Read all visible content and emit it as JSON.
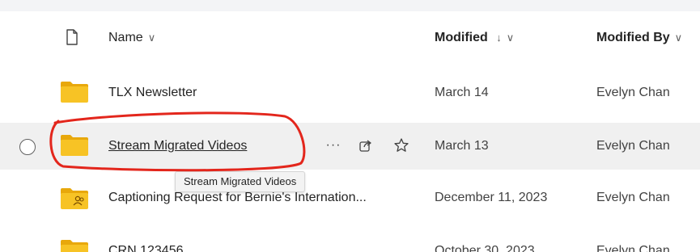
{
  "header": {
    "name_label": "Name",
    "name_chevron": "∨",
    "modified_label": "Modified",
    "modified_sort": "↓",
    "modified_chevron": "∨",
    "modified_by_label": "Modified By",
    "modified_by_chevron": "∨"
  },
  "rows": [
    {
      "name": "TLX Newsletter",
      "modified": "March 14",
      "modified_by": "Evelyn Chan",
      "icon": "folder-icon"
    },
    {
      "name": "Stream Migrated Videos",
      "modified": "March 13",
      "modified_by": "Evelyn Chan",
      "icon": "folder-icon",
      "selected_hover": true
    },
    {
      "name": "Captioning Request for Bernie's Internation...",
      "modified": "December 11, 2023",
      "modified_by": "Evelyn Chan",
      "icon": "shared-folder-icon"
    },
    {
      "name": "CRN 123456",
      "modified": "October 30, 2023",
      "modified_by": "Evelyn Chan",
      "icon": "folder-icon"
    }
  ],
  "row_actions": {
    "more": "···",
    "share_icon": "share-icon",
    "favorite_icon": "star-icon"
  },
  "tooltip": {
    "text": "Stream Migrated Videos"
  },
  "colors": {
    "folder": "#f7c325",
    "folder_back": "#e8a80c",
    "hover_row": "#f0f0f0",
    "annotation": "#e3261c"
  }
}
